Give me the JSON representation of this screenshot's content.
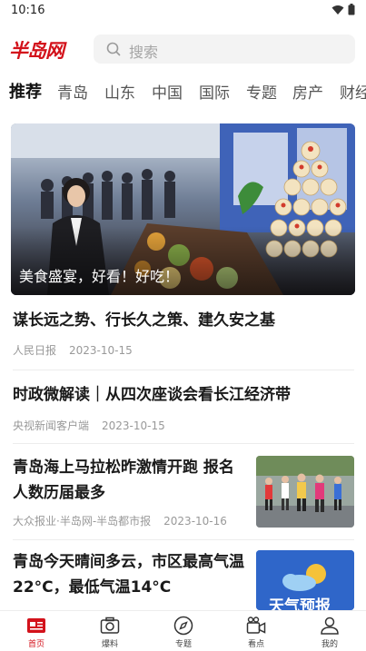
{
  "status_bar": {
    "time": "10:16"
  },
  "header": {
    "logo_text": "半岛网",
    "search_placeholder": "搜索"
  },
  "tabs": [
    "推荐",
    "青岛",
    "山东",
    "中国",
    "国际",
    "专题",
    "房产",
    "财经"
  ],
  "active_tab": "推荐",
  "hero": {
    "caption": "美食盛宴，好看！好吃！"
  },
  "news": [
    {
      "title": "谋长远之势、行长久之策、建久安之基",
      "source": "人民日报",
      "date": "2023-10-15"
    },
    {
      "title": "时政微解读｜从四次座谈会看长江经济带",
      "source": "央视新闻客户端",
      "date": "2023-10-15"
    },
    {
      "title_lines": [
        "青岛海上马拉松昨激情开跑 报名",
        "人数历届最多"
      ],
      "source": "大众报业·半岛网-半岛都市报",
      "date": "2023-10-16"
    },
    {
      "title_lines": [
        "青岛今天晴间多云，市区最高气温",
        "22°C，最低气温14°C"
      ],
      "thumb_text": "天气预报"
    }
  ],
  "bottom_nav": [
    {
      "label": "首页",
      "icon": "home-newspaper-icon"
    },
    {
      "label": "爆料",
      "icon": "camera-icon"
    },
    {
      "label": "专题",
      "icon": "compass-icon"
    },
    {
      "label": "看点",
      "icon": "video-camera-icon"
    },
    {
      "label": "我的",
      "icon": "user-icon"
    }
  ],
  "colors": {
    "brand_red": "#d3121b",
    "meta_gray": "#999999",
    "divider": "#ececec"
  }
}
